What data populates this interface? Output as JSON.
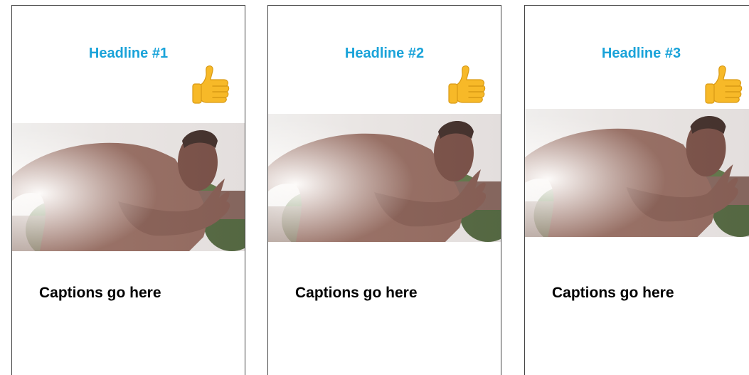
{
  "cards": [
    {
      "headline": "Headline #1",
      "reaction_icon": "thumbs-up-icon",
      "image": "sprinter-photo",
      "caption": "Captions go here"
    },
    {
      "headline": "Headline #2",
      "reaction_icon": "thumbs-up-icon",
      "image": "sprinter-photo",
      "caption": "Captions go here"
    },
    {
      "headline": "Headline #3",
      "reaction_icon": "thumbs-up-icon",
      "image": "sprinter-photo",
      "caption": "Captions go here"
    }
  ],
  "colors": {
    "headline": "#1aa3d9",
    "caption": "#000000",
    "card_border": "#444444",
    "thumb": "#f7b928"
  }
}
